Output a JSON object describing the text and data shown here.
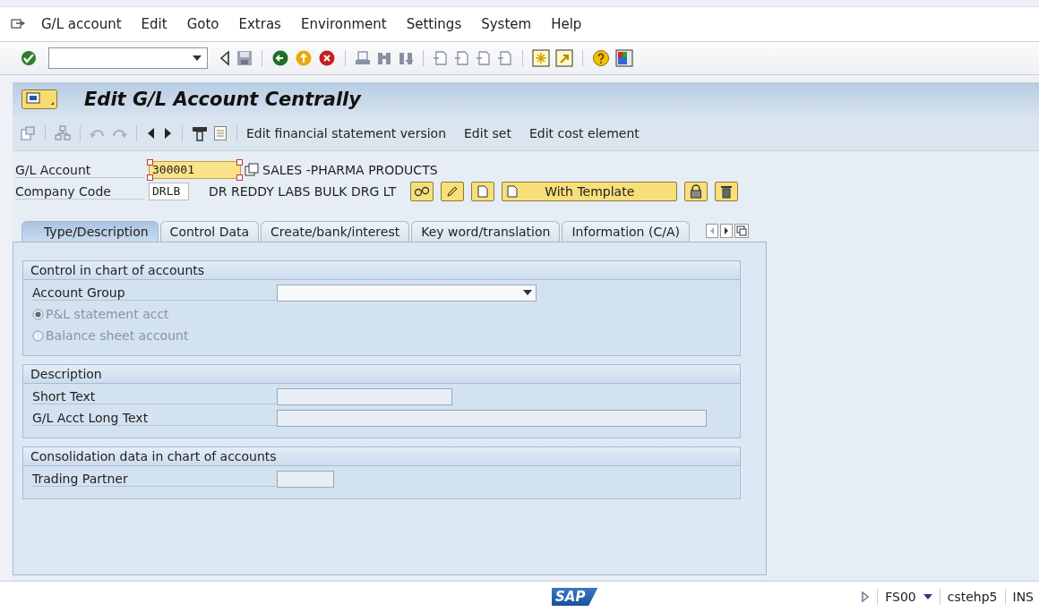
{
  "menu": [
    "G/L account",
    "Edit",
    "Goto",
    "Extras",
    "Environment",
    "Settings",
    "System",
    "Help"
  ],
  "title": "Edit G/L Account Centrally",
  "app_toolbar": [
    "Edit financial statement version",
    "Edit set",
    "Edit cost element"
  ],
  "header": [
    {
      "label": "G/L Account",
      "value": "300001",
      "description": "SALES -PHARMA PRODUCTS",
      "focused": true
    },
    {
      "label": "Company Code",
      "value": "DRLB",
      "description": "DR REDDY LABS BULK DRG LT",
      "focused": false
    }
  ],
  "template_button": "With Template",
  "tabs": [
    {
      "label": "Type/Description",
      "selected": true
    },
    {
      "label": "Control Data",
      "selected": false
    },
    {
      "label": "Create/bank/interest",
      "selected": false
    },
    {
      "label": "Key word/translation",
      "selected": false
    },
    {
      "label": "Information (C/A)",
      "selected": false
    }
  ],
  "groups": [
    {
      "title": "Control in chart of accounts",
      "rows": [
        {
          "kind": "dropdown",
          "label": "Account Group"
        },
        {
          "kind": "radio",
          "label": "P&L statement acct",
          "selected": true,
          "disabled": true
        },
        {
          "kind": "radio",
          "label": "Balance sheet account",
          "selected": false,
          "disabled": true
        }
      ]
    },
    {
      "title": "Description",
      "rows": [
        {
          "kind": "input",
          "label": "Short Text"
        },
        {
          "kind": "input",
          "label": "G/L Acct Long Text"
        }
      ]
    },
    {
      "title": "Consolidation data in chart of accounts",
      "rows": [
        {
          "kind": "input",
          "label": "Trading Partner"
        }
      ]
    }
  ],
  "status_bar": {
    "logo": "SAP",
    "transaction": "FS00",
    "server": "cstehp5",
    "mode": "INS"
  }
}
